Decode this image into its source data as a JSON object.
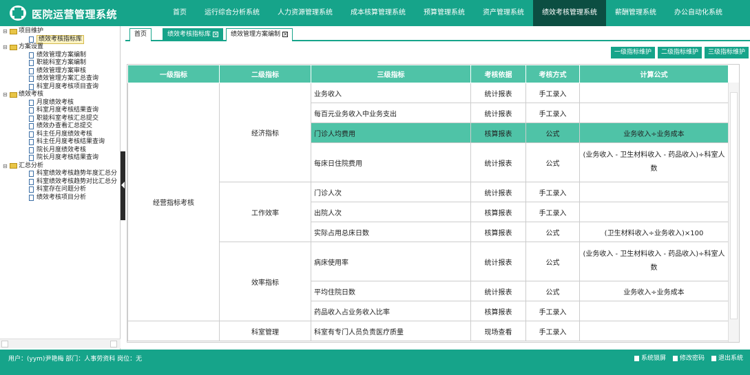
{
  "app": {
    "title": "医院运营管理系统"
  },
  "topnav": [
    "首页",
    "运行综合分析系统",
    "人力资源管理系统",
    "成本核算管理系统",
    "预算管理系统",
    "资产管理系统",
    "绩效考核管理系统",
    "薪酬管理系统",
    "办公自动化系统"
  ],
  "sidebar": {
    "tree": [
      {
        "label": "项目维护",
        "type": "folder",
        "expander": "⊟"
      },
      {
        "label": "绩效考核指标库",
        "type": "leaf",
        "selected": true
      },
      {
        "label": "方案设置",
        "type": "folder",
        "expander": "⊟"
      },
      {
        "label": "绩效管理方案编制",
        "type": "leaf"
      },
      {
        "label": "职能科室方案编制",
        "type": "leaf"
      },
      {
        "label": "绩效管理方案审核",
        "type": "leaf"
      },
      {
        "label": "绩效管理方案汇总查询",
        "type": "leaf"
      },
      {
        "label": "科室月度考核项目查询",
        "type": "leaf"
      },
      {
        "label": "绩效考核",
        "type": "folder",
        "expander": "⊟"
      },
      {
        "label": "月度绩效考核",
        "type": "leaf"
      },
      {
        "label": "科室月度考核结果查询",
        "type": "leaf"
      },
      {
        "label": "职能科室考核汇总提交",
        "type": "leaf"
      },
      {
        "label": "绩效办查看汇总提交",
        "type": "leaf"
      },
      {
        "label": "科主任月度绩效考核",
        "type": "leaf"
      },
      {
        "label": "科主任月度考核结果查询",
        "type": "leaf"
      },
      {
        "label": "院长月度绩效考核",
        "type": "leaf"
      },
      {
        "label": "院长月度考核结果查询",
        "type": "leaf"
      },
      {
        "label": "汇总分析",
        "type": "folder",
        "expander": "⊟"
      },
      {
        "label": "科室绩效考核趋势年度汇总分",
        "type": "leaf"
      },
      {
        "label": "科室绩效考核趋势对比汇总分",
        "type": "leaf"
      },
      {
        "label": "科室存在问题分析",
        "type": "leaf"
      },
      {
        "label": "绩效考核项目分析",
        "type": "leaf"
      }
    ]
  },
  "tabs": [
    {
      "label": "首页"
    },
    {
      "label": "绩效考核指标库",
      "close": "×"
    },
    {
      "label": "绩效管理方案编制",
      "close": "×"
    }
  ],
  "buttons": {
    "level1": "一级指标维护",
    "level2": "二级指标维护",
    "level3": "三级指标维护"
  },
  "table": {
    "headers": [
      "一级指标",
      "二级指标",
      "三级指标",
      "考核依据",
      "考核方式",
      "计算公式"
    ],
    "level1": [
      "经营指标考核"
    ],
    "level2": [
      "经济指标",
      "工作效率",
      "效率指标",
      "科室管理"
    ],
    "rows": [
      {
        "l3": "业务收入",
        "basis": "统计报表",
        "method": "手工录入",
        "formula": ""
      },
      {
        "l3": "每百元业务收入中业务支出",
        "basis": "统计报表",
        "method": "手工录入",
        "formula": ""
      },
      {
        "l3": "门诊人均费用",
        "basis": "核算报表",
        "method": "公式",
        "formula": "业务收入÷业务成本"
      },
      {
        "l3": "每床日住院费用",
        "basis": "统计报表",
        "method": "公式",
        "formula": "(业务收入 - 卫生材料收入 - 药品收入)÷科室人数"
      },
      {
        "l3": "门诊人次",
        "basis": "统计报表",
        "method": "手工录入",
        "formula": ""
      },
      {
        "l3": "出院人次",
        "basis": "核算报表",
        "method": "手工录入",
        "formula": ""
      },
      {
        "l3": "实际占用总床日数",
        "basis": "核算报表",
        "method": "公式",
        "formula": "(卫生材料收入÷业务收入)×100"
      },
      {
        "l3": "病床使用率",
        "basis": "统计报表",
        "method": "公式",
        "formula": "(业务收入 - 卫生材料收入 - 药品收入)÷科室人数"
      },
      {
        "l3": "平均住院日数",
        "basis": "统计报表",
        "method": "公式",
        "formula": "业务收入÷业务成本"
      },
      {
        "l3": "药品收入占业务收入比率",
        "basis": "核算报表",
        "method": "手工录入",
        "formula": ""
      },
      {
        "l3": "科室有专门人员负责医疗质量",
        "basis": "现场查看",
        "method": "手工录入",
        "formula": ""
      }
    ]
  },
  "statusbar": {
    "user": "用户：(yym)尹艳梅 部门：人事劳资科 岗位：无",
    "lock": "系统锁屏",
    "password": "修改密码",
    "logout": "退出系统"
  },
  "colors": {
    "brand": "#16a48a",
    "header": "#4fc3a7",
    "active_nav": "#0c4e42"
  }
}
